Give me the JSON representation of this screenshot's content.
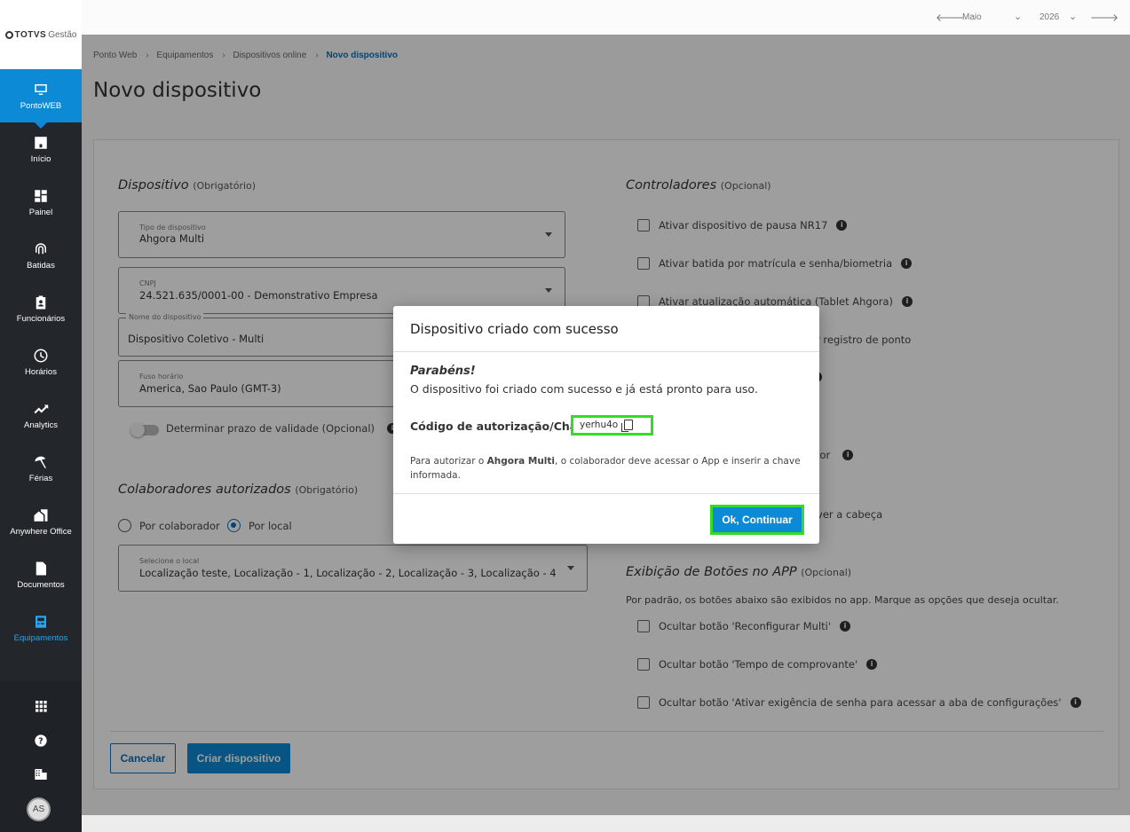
{
  "brand": {
    "name": "TOTVS",
    "suffix": "Gestão"
  },
  "topbar": {
    "month": "Maio",
    "year": "2026"
  },
  "sidebar": {
    "module": "PontoWEB",
    "items": [
      {
        "label": "Início"
      },
      {
        "label": "Painel"
      },
      {
        "label": "Batidas"
      },
      {
        "label": "Funcionários"
      },
      {
        "label": "Horários"
      },
      {
        "label": "Analytics"
      },
      {
        "label": "Férias"
      },
      {
        "label": "Anywhere Office"
      },
      {
        "label": "Documentos"
      },
      {
        "label": "Equipamentos"
      }
    ],
    "avatar": "AS"
  },
  "breadcrumb": [
    "Ponto Web",
    "Equipamentos",
    "Dispositivos online",
    "Novo dispositivo"
  ],
  "page_title": "Novo dispositivo",
  "device_section": {
    "title": "Dispositivo",
    "hint": "(Obrigatório)",
    "type": {
      "label": "Tipo de dispositivo",
      "value": "Ahgora Multi"
    },
    "cnpj": {
      "label": "CNPJ",
      "value": "24.521.635/0001-00 - Demonstrativo Empresa"
    },
    "name": {
      "label": "Nome do dispositivo",
      "value": "Dispositivo Coletivo - Multi"
    },
    "timezone": {
      "label": "Fuso horário",
      "value": "America, Sao Paulo (GMT-3)"
    },
    "validity_toggle": "Determinar prazo de validade (Opcional)"
  },
  "collab_section": {
    "title": "Colaboradores autorizados",
    "hint": "(Obrigatório)",
    "radio_collab": "Por colaborador",
    "radio_local": "Por local",
    "local": {
      "label": "Selecione o local",
      "value": "Localização teste, Localização - 1, Localização - 2, Localização - 3, Localização - 4"
    }
  },
  "controllers": {
    "title": "Controladores",
    "hint": "(Opcional)",
    "items": [
      "Ativar dispositivo de pausa NR17",
      "Ativar batida por matrícula e senha/biometria",
      "Ativar atualização automática (Tablet Ahgora)"
    ],
    "partial_1": "ar registro de ponto",
    "partial_2": "stor",
    "partial_3": "over a cabeça"
  },
  "buttons_section": {
    "title": "Exibição de Botões no APP",
    "hint": "(Opcional)",
    "desc": "Por padrão, os botões abaixo são exibidos no app. Marque as opções que deseja ocultar.",
    "items": [
      "Ocultar botão 'Reconfigurar Multi'",
      "Ocultar botão 'Tempo de comprovante'",
      "Ocultar botão 'Ativar exigência de senha para acessar a aba de configurações'"
    ]
  },
  "actions": {
    "cancel": "Cancelar",
    "create": "Criar dispositivo"
  },
  "modal": {
    "title": "Dispositivo criado com sucesso",
    "congrats": "Parabéns!",
    "message": "O dispositivo foi criado com sucesso e já está pronto para uso.",
    "code_label": "Código de autorização/Chave:",
    "code": "yerhu4o",
    "note_prefix": "Para autorizar o ",
    "note_device": "Ahgora Multi",
    "note_suffix": ", o colaborador deve acessar o App e inserir a chave informada.",
    "ok": "Ok, Continuar"
  }
}
